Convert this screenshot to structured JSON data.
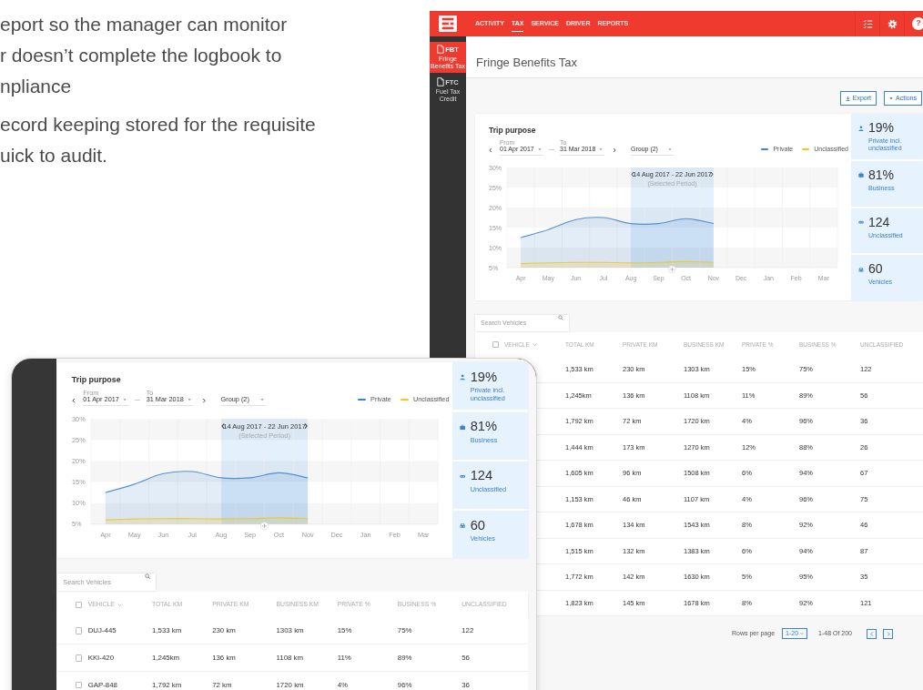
{
  "intro": {
    "paragraphs": [
      {
        "lines": [
          "eport so the manager can monitor",
          "r doesn’t complete the logbook to",
          "npliance"
        ]
      },
      {
        "lines": [
          "ecord keeping stored for the requisite",
          "uick to audit."
        ]
      }
    ]
  },
  "app_window": {
    "nav_tabs": [
      {
        "label": "ACTIVITY",
        "selected": false
      },
      {
        "label": "TAX",
        "selected": true
      },
      {
        "label": "SERVICE",
        "selected": false
      },
      {
        "label": "DRIVER",
        "selected": false
      },
      {
        "label": "REPORTS",
        "selected": false
      }
    ],
    "help_label": "?",
    "sidebar": {
      "items": [
        {
          "abbr": "FBT",
          "label": "Fringe Benefits Tax",
          "selected": true
        },
        {
          "abbr": "FTC",
          "label": "Fuel Tax Credit",
          "selected": false
        }
      ]
    },
    "page_title": "Fringe Benefits Tax",
    "buttons": [
      {
        "kind": "export",
        "label": "Export"
      },
      {
        "kind": "actions",
        "label": "Actions"
      }
    ],
    "trip_purpose": {
      "title": "Trip purpose",
      "from": {
        "label": "From",
        "value": "01 Apr 2017"
      },
      "to": {
        "label": "To",
        "value": "31 Mar 2018"
      },
      "group": "Group (2)",
      "selected_period": {
        "label": "14 Aug 2017 - 22 Jun 2017",
        "note": "(Selected Period)",
        "months_selected": [
          false,
          false,
          false,
          false,
          true,
          true,
          true,
          true,
          false,
          false,
          false,
          false
        ]
      },
      "chart_data": {
        "type": "area",
        "categories": [
          "Apr",
          "May",
          "Jun",
          "Jul",
          "Aug",
          "Sep",
          "Oct",
          "Nov",
          "Dec",
          "Jan",
          "Feb",
          "Mar"
        ],
        "series": [
          {
            "name": "Private",
            "color": "#3b82d0",
            "values": [
              12.5,
              14.5,
              17,
              17.5,
              16,
              16,
              17.2,
              16,
              null,
              null,
              null,
              null
            ]
          },
          {
            "name": "Unclassified",
            "color": "#f5c518",
            "values": [
              6,
              6.2,
              6.3,
              6.3,
              6.2,
              6.3,
              6.5,
              6.3,
              null,
              null,
              null,
              null
            ]
          }
        ],
        "ylim": [
          5,
          30
        ],
        "yticks": [
          {
            "value": 5,
            "label": "5%"
          },
          {
            "value": 10,
            "label": "10%"
          },
          {
            "value": 15,
            "label": "15%"
          },
          {
            "value": 20,
            "label": "20%"
          },
          {
            "value": 25,
            "label": "25%"
          },
          {
            "value": 30,
            "label": "30%"
          }
        ]
      },
      "stats": [
        {
          "kind": "person",
          "value": "19%",
          "label": "Private incl. unclassified"
        },
        {
          "kind": "briefcase",
          "value": "81%",
          "label": "Business"
        },
        {
          "kind": "mask",
          "value": "124",
          "label": "Unclassified"
        },
        {
          "kind": "car",
          "value": "60",
          "label": "Vehicles"
        }
      ]
    },
    "search": {
      "placeholder": "Search Vehicles"
    },
    "table": {
      "all_checked": false,
      "columns": [
        {
          "label": "VEHICLE",
          "sorted": true
        },
        {
          "label": "TOTAL KM",
          "sorted": false
        },
        {
          "label": "PRIVATE KM",
          "sorted": false
        },
        {
          "label": "BUSINESS KM",
          "sorted": false
        },
        {
          "label": "PRIVATE %",
          "sorted": false
        },
        {
          "label": "BUSINESS %",
          "sorted": false
        },
        {
          "label": "UNCLASSIFIED",
          "sorted": false
        }
      ],
      "rows": [
        {
          "cells": [
            "",
            "1,533 km",
            "230 km",
            "1303 km",
            "15%",
            "75%",
            "122"
          ]
        },
        {
          "cells": [
            "",
            "1,245km",
            "136 km",
            "1108 km",
            "11%",
            "89%",
            "56"
          ]
        },
        {
          "cells": [
            "",
            "1,792 km",
            "72 km",
            "1720 km",
            "4%",
            "96%",
            "36"
          ]
        },
        {
          "cells": [
            "",
            "1,444 km",
            "173 km",
            "1270 km",
            "12%",
            "88%",
            "26"
          ]
        },
        {
          "cells": [
            "",
            "1,605 km",
            "96 km",
            "1508 km",
            "6%",
            "94%",
            "67"
          ]
        },
        {
          "cells": [
            "",
            "1,153 km",
            "46 km",
            "1107 km",
            "4%",
            "96%",
            "75"
          ]
        },
        {
          "cells": [
            "",
            "1,678 km",
            "134 km",
            "1543 km",
            "8%",
            "92%",
            "46"
          ]
        },
        {
          "cells": [
            "",
            "1,515 km",
            "132 km",
            "1383 km",
            "6%",
            "94%",
            "87"
          ]
        },
        {
          "cells": [
            "",
            "1,772 km",
            "142 km",
            "1630 km",
            "5%",
            "95%",
            "35"
          ]
        },
        {
          "cells": [
            "",
            "1,823 km",
            "145 km",
            "1678 km",
            "8%",
            "92%",
            "121"
          ]
        }
      ]
    },
    "pagination": {
      "rows_per_page_label": "Rows per page",
      "rows_per_page": "1-20",
      "range": "1-48 Of 200"
    }
  },
  "device_window": {
    "trip_purpose": {
      "title": "Trip purpose",
      "from": {
        "label": "From",
        "value": "01 Apr 2017"
      },
      "to": {
        "label": "To",
        "value": "31 Mar 2018"
      },
      "group": "Group (2)",
      "selected_period": {
        "label": "14 Aug 2017 - 22 Jun 2017",
        "note": "(Selected Period)",
        "months_selected": [
          false,
          false,
          false,
          false,
          true,
          true,
          true,
          true,
          false,
          false,
          false,
          false
        ]
      },
      "chart_data": {
        "type": "area",
        "categories": [
          "Apr",
          "May",
          "Jun",
          "Jul",
          "Aug",
          "Sep",
          "Oct",
          "Nov",
          "Dec",
          "Jan",
          "Feb",
          "Mar"
        ],
        "series": [
          {
            "name": "Private",
            "color": "#3b82d0",
            "values": [
              12.5,
              14.5,
              17,
              17.5,
              16,
              16,
              17.2,
              16,
              null,
              null,
              null,
              null
            ]
          },
          {
            "name": "Unclassified",
            "color": "#f5c518",
            "values": [
              6,
              6.2,
              6.3,
              6.3,
              6.2,
              6.3,
              6.5,
              6.3,
              null,
              null,
              null,
              null
            ]
          }
        ],
        "ylim": [
          5,
          30
        ],
        "yticks": [
          {
            "value": 5,
            "label": "5%"
          },
          {
            "value": 10,
            "label": "10%"
          },
          {
            "value": 15,
            "label": "15%"
          },
          {
            "value": 20,
            "label": "20%"
          },
          {
            "value": 25,
            "label": "25%"
          },
          {
            "value": 30,
            "label": "30%"
          }
        ]
      },
      "stats": [
        {
          "kind": "person",
          "value": "19%",
          "label": "Private incl. unclassified"
        },
        {
          "kind": "briefcase",
          "value": "81%",
          "label": "Business"
        },
        {
          "kind": "mask",
          "value": "124",
          "label": "Unclassified"
        },
        {
          "kind": "car",
          "value": "60",
          "label": "Vehicles"
        }
      ]
    },
    "search": {
      "placeholder": "Search Vehicles"
    },
    "table": {
      "all_checked": false,
      "columns": [
        {
          "label": "VEHICLE",
          "sorted": true
        },
        {
          "label": "TOTAL KM",
          "sorted": false
        },
        {
          "label": "PRIVATE KM",
          "sorted": false
        },
        {
          "label": "BUSINESS KM",
          "sorted": false
        },
        {
          "label": "PRIVATE %",
          "sorted": false
        },
        {
          "label": "BUSINESS %",
          "sorted": false
        },
        {
          "label": "UNCLASSIFIED",
          "sorted": false
        }
      ],
      "rows": [
        {
          "checked": false,
          "cells": [
            "DUJ-445",
            "1,533 km",
            "230 km",
            "1303 km",
            "15%",
            "75%",
            "122"
          ]
        },
        {
          "checked": false,
          "cells": [
            "KKI-420",
            "1,245km",
            "136 km",
            "1108 km",
            "11%",
            "89%",
            "56"
          ]
        },
        {
          "checked": false,
          "cells": [
            "GAP-848",
            "1,792 km",
            "72 km",
            "1720 km",
            "4%",
            "96%",
            "36"
          ]
        }
      ]
    }
  }
}
